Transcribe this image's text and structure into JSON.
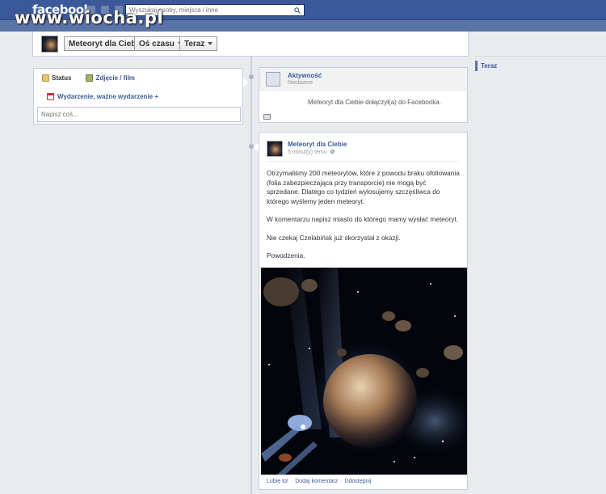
{
  "watermark": "www.wiocha.pl",
  "header": {
    "logo": "facebook",
    "search_placeholder": "Wyszukaj osoby, miejsca i inne"
  },
  "timeline": {
    "page_name": "Meteoryt dla Ciebie",
    "timeline_menu": "Oś czasu",
    "now_menu": "Teraz"
  },
  "right_nav": {
    "now": "Teraz"
  },
  "composer": {
    "tab_status": "Status",
    "tab_photo": "Zdjęcie / film",
    "event": "Wydarzenie, ważne wydarzenie +",
    "placeholder": "Napisz coś..."
  },
  "activity": {
    "title": "Aktywność",
    "subtitle": "Niedawne",
    "text": "Meteoryt dla Ciebie dołączył(a) do Facebooka."
  },
  "post": {
    "author": "Meteoryt dla Ciebie",
    "time": "5 minut(y) temu",
    "paragraphs": [
      "Otrzymaliśmy 200 meteorytów, które z powodu braku ofoliowania (folia zabezpieczająca przy transporcie) nie mogą być sprzedane. Dlatego co tydzień wylosujemy szczęśliwca do którego wyślemy jeden meteoryt.",
      "W komentarzu napisz miasto do którego mamy wysłać meteoryt.",
      "Nie czekaj Czelabińsk już skorzystał z okazji.",
      "Powodzenia."
    ],
    "like": "Lubię to!",
    "comment": "Dodaj komentarz",
    "share": "Udostępnij",
    "separator": "·"
  },
  "colors": {
    "brand": "#3b5998",
    "page_bg": "#e9ebee"
  }
}
